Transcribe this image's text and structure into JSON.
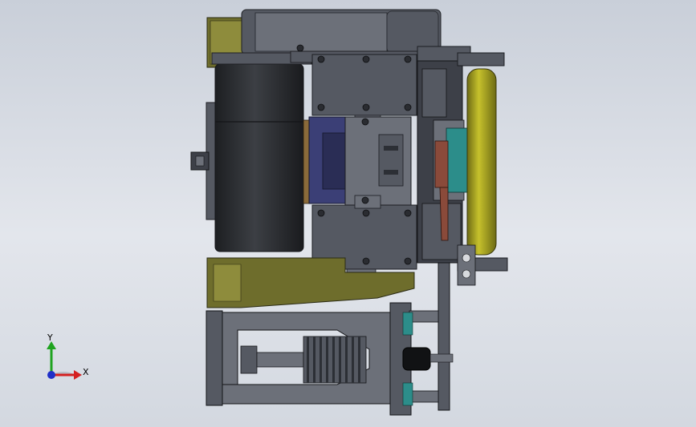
{
  "viewport": {
    "background_top": "#c9cfd9",
    "background_bottom": "#d3d8e0"
  },
  "triad": {
    "x_label": "X",
    "y_label": "Y",
    "x_color": "#d42020",
    "y_color": "#1fa31f",
    "z_color": "#2030c8"
  },
  "model_colors": {
    "steel_dark": "#3d4048",
    "steel_mid": "#555962",
    "steel_light": "#6c7079",
    "olive": "#6e6d2c",
    "olive_light": "#8e8c3c",
    "roller_yellow": "#b5b024",
    "navy": "#3b3f76",
    "teal": "#2c8d8a",
    "rust": "#8a4a3a",
    "brass": "#8a6a3a"
  }
}
